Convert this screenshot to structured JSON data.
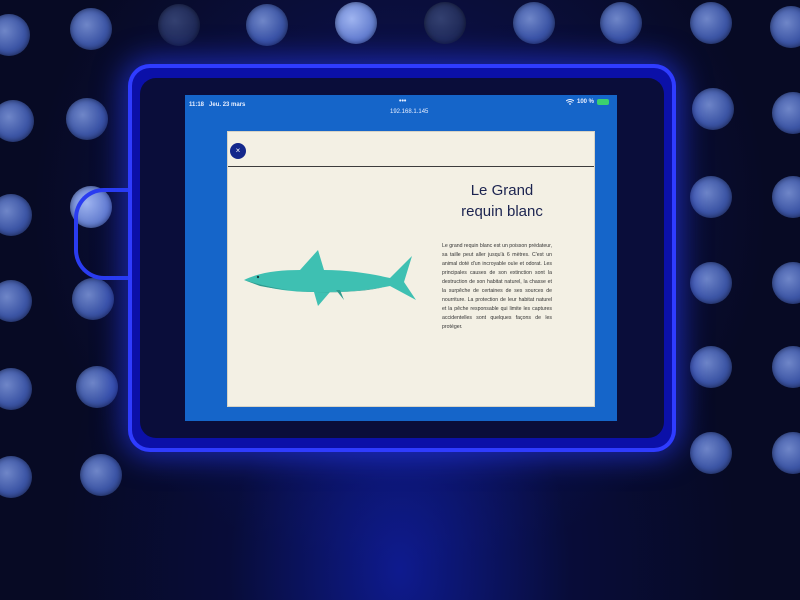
{
  "status_bar": {
    "time": "11:18",
    "date": "Jeu. 23 mars",
    "multitask_dots": "•••",
    "url": "192.168.1.145",
    "battery_text": "100 %"
  },
  "card": {
    "close_icon": "×",
    "title_line1": "Le Grand",
    "title_line2": "requin blanc",
    "description": "Le grand requin blanc est un poisson prédateur, sa taille peut aller jusqu'à 6 mètres. C'est un animal doté d'un incroyable ouïe et odorat. Les principales causes de son extinction sont la destruction de son habitat naturel, la chasse et la surpêche de certaines de ses sources de nourriture. La protection de leur habitat naturel et la pêche responsable qui limite les captures accidentelles sont quelques façons de les protéger."
  },
  "colors": {
    "shark": "#3ec0b2",
    "shark_shadow": "#2f9a8e",
    "screen_bg": "#1565c9",
    "card_bg": "#f3f0e4",
    "case": "#0b10a8"
  },
  "icons": [
    "close-icon",
    "wifi-icon",
    "battery-icon",
    "shark-illustration"
  ]
}
